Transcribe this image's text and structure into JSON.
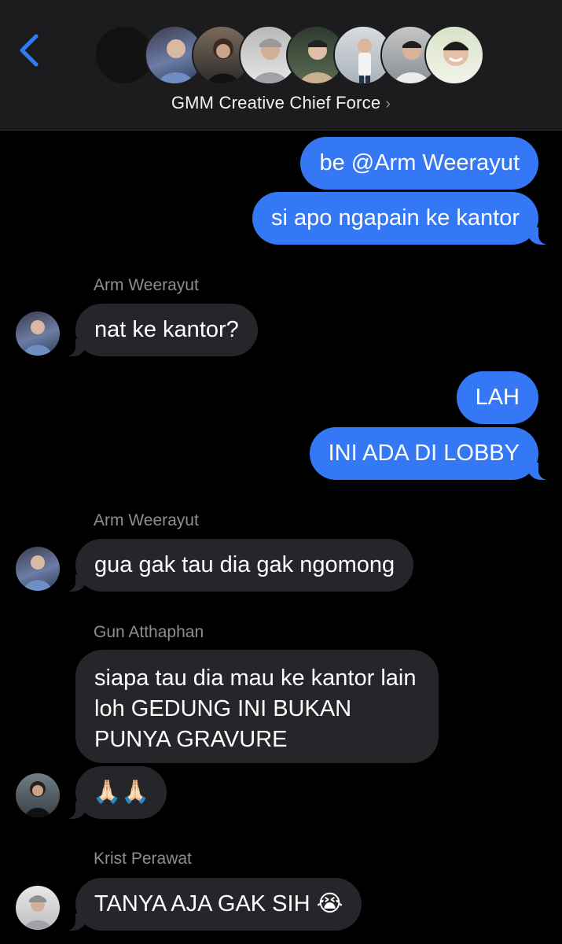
{
  "header": {
    "group_name": "GMM Creative Chief Force",
    "chevron": "›",
    "back_icon": "chevron-left-icon",
    "accent": "#2f7cf6"
  },
  "messages": [
    {
      "side": "out",
      "text": "be @Arm Weerayut"
    },
    {
      "side": "out",
      "text": "si apo ngapain ke kantor"
    },
    {
      "side": "in",
      "sender": "Arm Weerayut",
      "text": "nat ke kantor?"
    },
    {
      "side": "out",
      "text": "LAH"
    },
    {
      "side": "out",
      "text": "INI ADA DI LOBBY"
    },
    {
      "side": "in",
      "sender": "Arm Weerayut",
      "text": "gua gak tau dia gak ngomong"
    },
    {
      "side": "in",
      "sender": "Gun Atthaphan",
      "text": "siapa tau dia mau ke kantor lain loh GEDUNG INI BUKAN PUNYA GRAVURE"
    },
    {
      "side": "in",
      "text": "🙏🏻🙏🏻"
    },
    {
      "side": "in",
      "sender": "Krist Perawat",
      "text": "TANYA AJA GAK SIH 😭"
    }
  ],
  "colors": {
    "outgoing_bubble": "#3478f6",
    "incoming_bubble": "#26252a",
    "background": "#000000",
    "header": "#1c1c1e"
  }
}
